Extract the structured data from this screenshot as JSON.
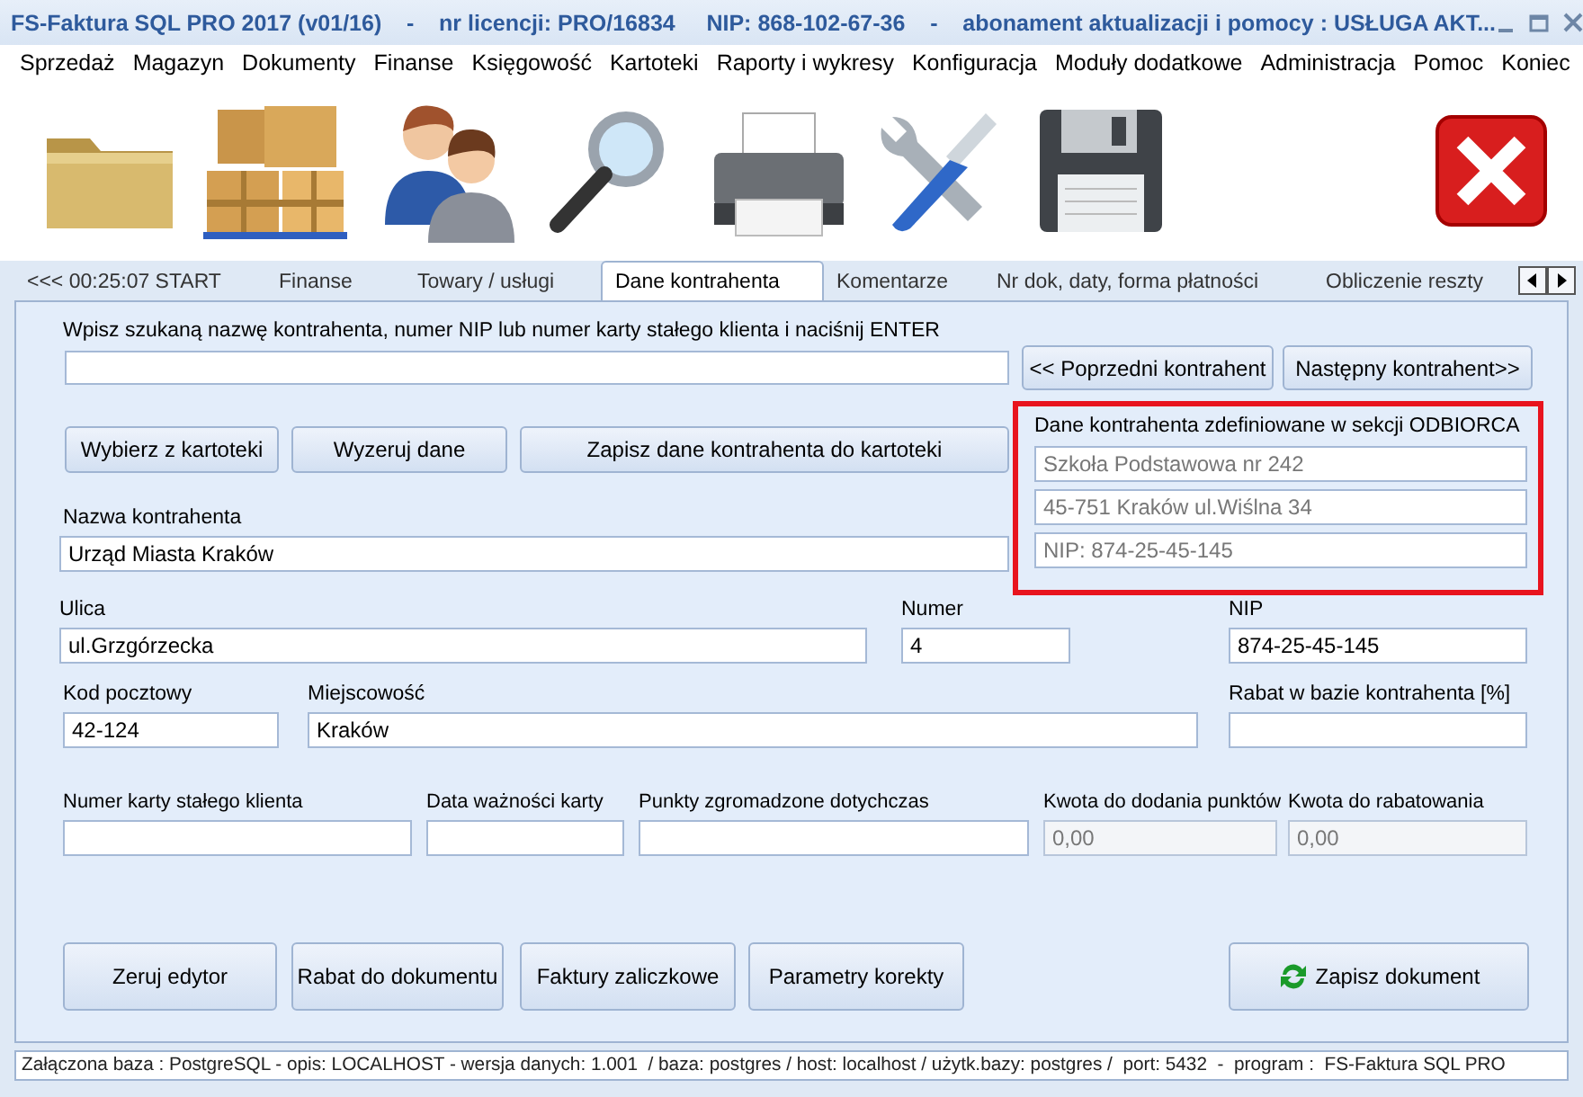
{
  "window": {
    "title": "FS-Faktura SQL PRO 2017 (v01/16)    -    nr licencji: PRO/16834     NIP: 868-102-67-36    -    abonament aktualizacji i pomocy : USŁUGA AKT..."
  },
  "menu": [
    "Sprzedaż",
    "Magazyn",
    "Dokumenty",
    "Finanse",
    "Księgowość",
    "Kartoteki",
    "Raporty i wykresy",
    "Konfiguracja",
    "Moduły dodatkowe",
    "Administracja",
    "Pomoc",
    "Koniec"
  ],
  "tabs": [
    {
      "label": "<<<  00:25:07  START",
      "selected": false
    },
    {
      "label": "Finanse",
      "selected": false
    },
    {
      "label": "Towary  / usługi",
      "selected": false
    },
    {
      "label": "Dane kontrahenta",
      "selected": true
    },
    {
      "label": "Komentarze",
      "selected": false
    },
    {
      "label": "Nr dok, daty, forma płatności",
      "selected": false
    },
    {
      "label": "Obliczenie reszty",
      "selected": false
    }
  ],
  "search": {
    "label": "Wpisz szukaną nazwę kontrahenta, numer NIP lub numer karty stałego klienta i naciśnij ENTER",
    "buttons": [
      "<< Poprzedni kontrahent",
      "Następny kontrahent>>"
    ]
  },
  "contractor_buttons": [
    "Wybierz z kartoteki",
    "Wyzeruj dane",
    "Zapisz dane kontrahenta do kartoteki"
  ],
  "recipient": {
    "title": "Dane kontrahenta zdefiniowane w sekcji ODBIORCA",
    "lines": [
      "Szkoła Podstawowa nr 242",
      "45-751 Kraków ul.Wiślna 34",
      "NIP: 874-25-45-145"
    ]
  },
  "name_field": {
    "label": "Nazwa kontrahenta",
    "value": "Urząd Miasta Kraków"
  },
  "rows": [
    [
      {
        "label": "Ulica",
        "value": "ul.Grzgórzecka",
        "disabled": false
      },
      {
        "label": "Numer",
        "value": "4",
        "disabled": false
      },
      {
        "label": "NIP",
        "value": "874-25-45-145",
        "disabled": false
      }
    ],
    [
      {
        "label": "Kod pocztowy",
        "value": "42-124",
        "disabled": false
      },
      {
        "label": "Miejscowość",
        "value": "Kraków",
        "disabled": false
      },
      {
        "label": "Rabat w bazie kontrahenta  [%]",
        "disabled": false
      }
    ],
    [
      {
        "label": "Numer karty stałego klienta",
        "disabled": false
      },
      {
        "label": "Data ważności karty",
        "disabled": false
      },
      {
        "label": "Punkty zgromadzone dotychczas",
        "disabled": false
      },
      {
        "label": "Kwota do dodania punktów",
        "value": "0,00",
        "disabled": true
      },
      {
        "label": "Kwota do rabatowania",
        "value": "0,00",
        "disabled": true
      }
    ]
  ],
  "bottom_buttons": [
    {
      "label": "Zeruj edytor",
      "kind": "plain"
    },
    {
      "label": "Rabat do dokumentu",
      "kind": "plain"
    },
    {
      "label": "Faktury zaliczkowe",
      "kind": "plain"
    },
    {
      "label": "Parametry korekty",
      "kind": "plain"
    },
    {
      "label": "Zapisz dokument",
      "kind": "save"
    }
  ],
  "status_bar": "Załączona baza : PostgreSQL - opis: LOCALHOST - wersja danych: 1.001  / baza: postgres / host: localhost / użytk.bazy: postgres /  port: 5432  -  program :  FS-Faktura SQL PRO"
}
